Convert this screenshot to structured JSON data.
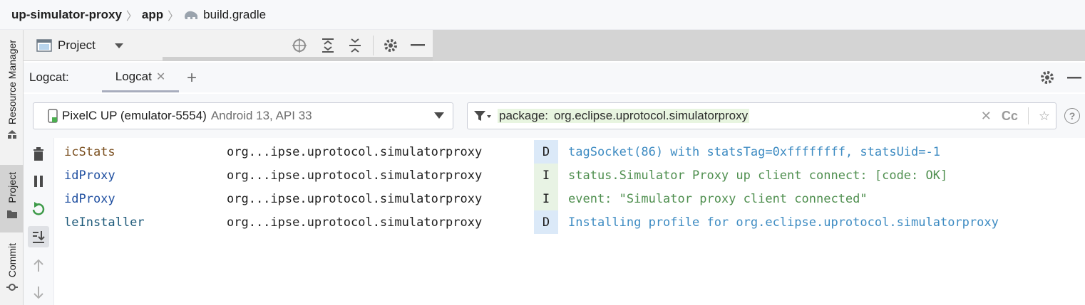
{
  "breadcrumb": {
    "project": "up-simulator-proxy",
    "module": "app",
    "file": "build.gradle"
  },
  "left_strip": {
    "resource_manager": "Resource Manager",
    "project": "Project",
    "commit": "Commit"
  },
  "project_panel": {
    "title": "Project"
  },
  "logcat": {
    "prefix": "Logcat:",
    "tab_label": "Logcat",
    "device": {
      "name": "PixelC UP (emulator-5554)",
      "api": "Android 13, API 33"
    },
    "filter": {
      "key": "package:",
      "value": "org.eclipse.uprotocol.simulatorproxy"
    },
    "case_toggle": "Cc"
  },
  "colors": {
    "debug_bg": "#dbe9f8",
    "info_bg": "#e8f3e4",
    "debug_text": "#3d8bc2",
    "info_text": "#4f8f4f",
    "tag_brown": "#7a4f1f",
    "tag_blue": "#1f4fa0"
  },
  "log_rows": [
    {
      "tag": "icStats",
      "package": "org...ipse.uprotocol.simulatorproxy",
      "level": "D",
      "message": "tagSocket(86) with statsTag=0xffffffff, statsUid=-1",
      "tag_color": "#7a4f1f"
    },
    {
      "tag": "idProxy",
      "package": "org...ipse.uprotocol.simulatorproxy",
      "level": "I",
      "message": "status.Simulator Proxy up client connect: [code: OK]",
      "tag_color": "#1f4fa0"
    },
    {
      "tag": "idProxy",
      "package": "org...ipse.uprotocol.simulatorproxy",
      "level": "I",
      "message": "event: \"Simulator proxy client connected\"",
      "tag_color": "#1f4fa0"
    },
    {
      "tag": "leInstaller",
      "package": "org...ipse.uprotocol.simulatorproxy",
      "level": "D",
      "message": "Installing profile for org.eclipse.uprotocol.simulatorproxy",
      "tag_color": "#1e5a7a"
    }
  ]
}
